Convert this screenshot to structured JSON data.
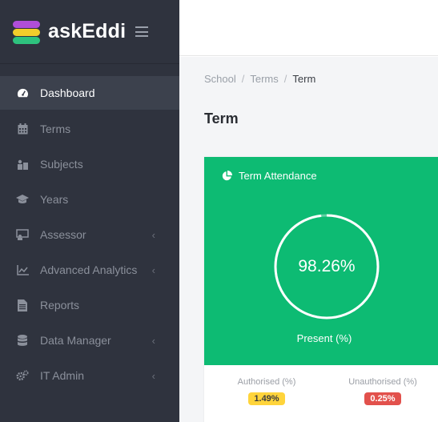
{
  "brand": {
    "name": "askEddi",
    "colors": [
      "#b04ed8",
      "#f2cd2b",
      "#2ec27e"
    ]
  },
  "sidebar": {
    "items": [
      {
        "label": "Dashboard",
        "icon": "dashboard-icon",
        "active": true
      },
      {
        "label": "Terms",
        "icon": "calendar-icon"
      },
      {
        "label": "Subjects",
        "icon": "subjects-icon"
      },
      {
        "label": "Years",
        "icon": "graduation-cap-icon"
      },
      {
        "label": "Assessor",
        "icon": "assessor-icon",
        "chevron": "‹"
      },
      {
        "label": "Advanced Analytics",
        "icon": "chart-icon",
        "chevron": "‹"
      },
      {
        "label": "Reports",
        "icon": "file-icon"
      },
      {
        "label": "Data Manager",
        "icon": "database-icon",
        "chevron": "‹"
      },
      {
        "label": "IT Admin",
        "icon": "cogs-icon",
        "chevron": "‹"
      }
    ]
  },
  "breadcrumb": {
    "items": [
      "School",
      "Terms",
      "Term"
    ],
    "separator": "/"
  },
  "page": {
    "title": "Term"
  },
  "attendance": {
    "title": "Term Attendance",
    "present_value": "98.26%",
    "present_fraction": 0.9826,
    "present_label": "Present (%)",
    "authorised_label": "Authorised (%)",
    "authorised_value": "1.49%",
    "unauthorised_label": "Unauthorised (%)",
    "unauthorised_value": "0.25%",
    "accent_color": "#0dbb73"
  }
}
